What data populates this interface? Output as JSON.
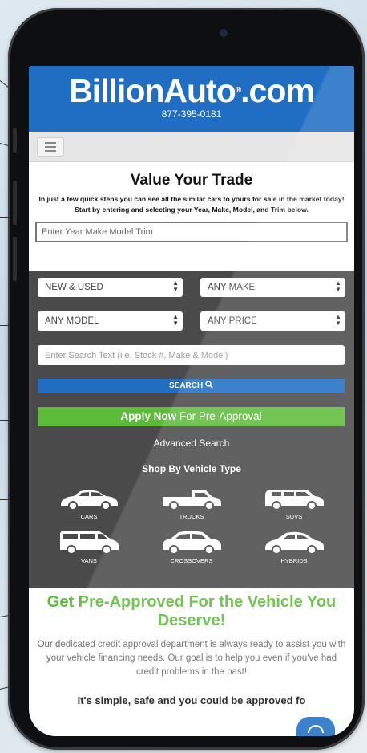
{
  "brand": {
    "logo_text": "BillionAuto",
    "logo_reg": "®",
    "logo_suffix": ".com",
    "phone": "877-395-0181",
    "color": "#1f6ec3"
  },
  "nav": {
    "menu_icon": "hamburger-icon"
  },
  "trade": {
    "title": "Value Your Trade",
    "intro": "In just a few quick steps you can see all the similar cars to yours for sale in the market today!",
    "instructions": "Start by entering and selecting your Year, Make, Model, and Trim below.",
    "input_placeholder": "Enter Year Make Model Trim"
  },
  "search": {
    "condition": "NEW & USED",
    "make": "ANY MAKE",
    "model": "ANY MODEL",
    "price": "ANY PRICE",
    "text_placeholder": "Enter Search Text (i.e. Stock #, Make & Model)",
    "search_label": "SEARCH",
    "search_icon": "magnifier-icon",
    "apply_bold": "Apply Now",
    "apply_rest": " For Pre-Approval",
    "advanced": "Advanced Search",
    "shop_title": "Shop By Vehicle Type",
    "vehicle_types": [
      "CARS",
      "TRUCKS",
      "SUVS",
      "VANS",
      "CROSSOVERS",
      "HYBRIDS"
    ],
    "accent_green": "#5dbb3a"
  },
  "promo": {
    "headline": "Get Pre-Approved For the Vehicle You Deserve!",
    "body": "Our dedicated credit approval department is always ready to assist you with your vehicle financing needs.  Our goal is to help you even if you've had credit problems in the past!",
    "simple": "It's simple, safe and you could be approved fo"
  },
  "chat": {
    "icon": "chat-icon"
  }
}
